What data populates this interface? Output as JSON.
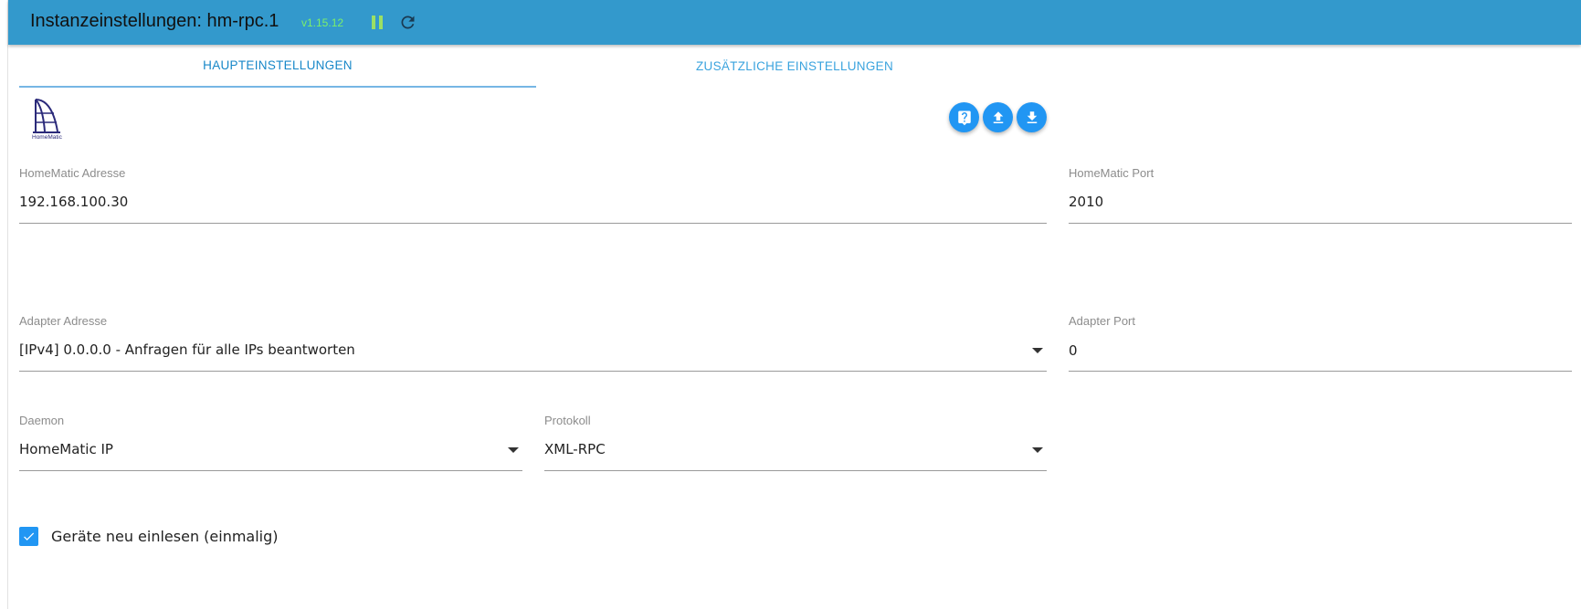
{
  "header": {
    "title": "Instanzeinstellungen: hm-rpc.1",
    "version": "v1.15.12",
    "pause_icon": "pause-icon",
    "reload_icon": "reload-icon"
  },
  "tabs": [
    {
      "label": "HAUPTEINSTELLUNGEN",
      "active": true
    },
    {
      "label": "ZUSÄTZLICHE EINSTELLUNGEN",
      "active": false
    }
  ],
  "logo": {
    "icon": "homematic-logo",
    "text": "HomeMatic"
  },
  "actions": {
    "help_icon": "help-icon",
    "upload_icon": "upload-icon",
    "download_icon": "download-icon"
  },
  "fields": {
    "homematic_address": {
      "label": "HomeMatic Adresse",
      "value": "192.168.100.30"
    },
    "homematic_port": {
      "label": "HomeMatic Port",
      "value": "2010"
    },
    "adapter_address": {
      "label": "Adapter Adresse",
      "value": "[IPv4] 0.0.0.0 - Anfragen für alle IPs beantworten"
    },
    "adapter_port": {
      "label": "Adapter Port",
      "value": "0"
    },
    "daemon": {
      "label": "Daemon",
      "value": "HomeMatic IP"
    },
    "protocol": {
      "label": "Protokoll",
      "value": "XML-RPC"
    }
  },
  "checkbox": {
    "label": "Geräte neu einlesen (einmalig)",
    "checked": true
  },
  "colors": {
    "header_bg": "#3399cc",
    "accent": "#2196f3",
    "version": "#7cf06a",
    "pause": "#9be064"
  }
}
